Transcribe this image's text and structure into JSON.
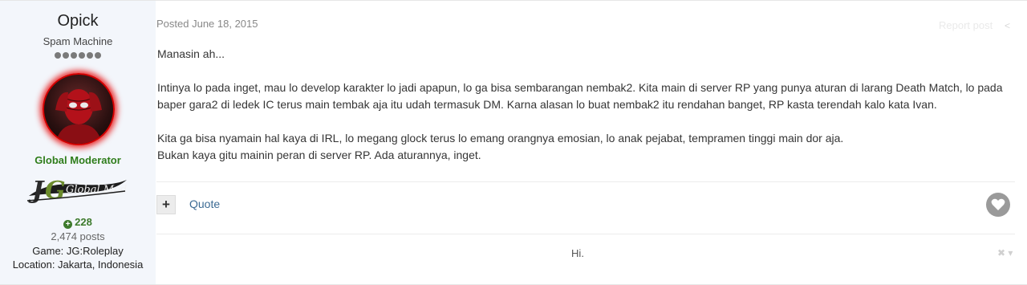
{
  "author": {
    "name": "Opick",
    "rank": "Spam Machine",
    "pips": 6,
    "group": "Global Moderator",
    "badge_text": "JG Global Mod",
    "reputation": "228",
    "posts": "2,474 posts",
    "game": "Game: JG:Roleplay",
    "location": "Location: Jakarta, Indonesia"
  },
  "post": {
    "posted": "Posted June 18, 2015",
    "report": "Report post",
    "paragraphs": [
      "Manasin ah...",
      "Intinya lo pada inget, mau lo develop karakter lo jadi apapun, lo ga bisa sembarangan nembak2. Kita main di server RP yang punya aturan di larang Death Match, lo pada baper gara2 di ledek IC terus main tembak aja itu udah termasuk DM. Karna alasan lo buat nembak2 itu rendahan banget, RP kasta terendah kalo kata Ivan."
    ],
    "lines": [
      "Kita ga bisa nyamain hal kaya di IRL, lo megang glock terus lo emang orangnya emosian, lo anak pejabat, tempramen tinggi main dor aja.",
      "Bukan kaya gitu mainin peran di server RP. Ada aturannya, inget."
    ]
  },
  "actions": {
    "multiquote": "+",
    "quote": "Quote"
  },
  "signature": {
    "text": "Hi."
  },
  "colors": {
    "group": "#2f7d1b",
    "link": "#3c6b94",
    "sidebar_bg": "#f3f6fb",
    "avatar_glow": "#e60000"
  }
}
